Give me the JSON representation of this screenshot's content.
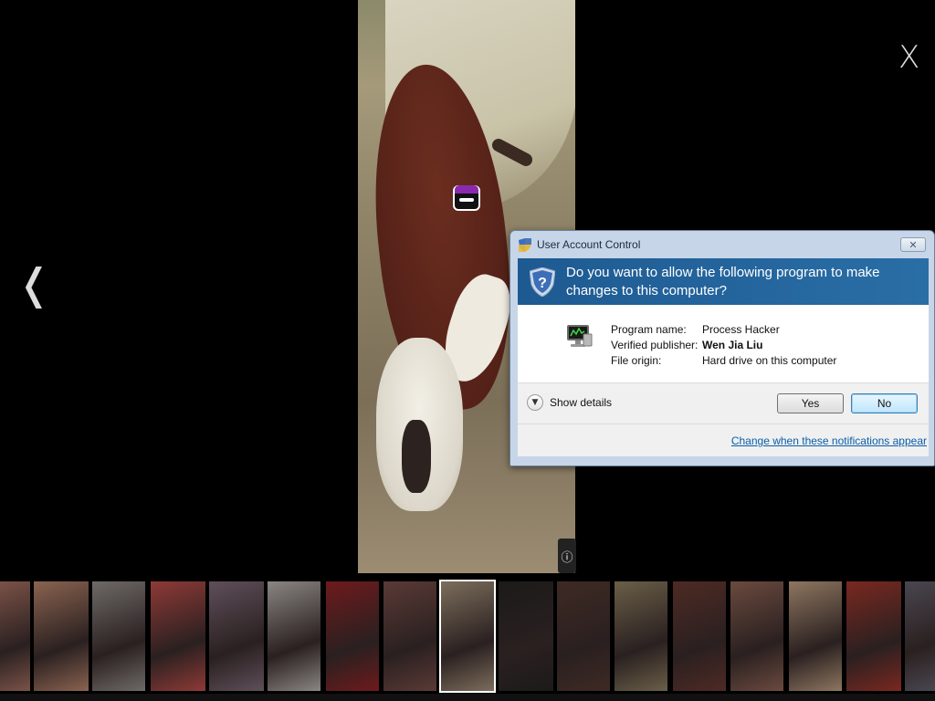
{
  "viewer": {
    "close_glyph": "X",
    "prev_glyph": "❬",
    "info_glyph": "ⓘ"
  },
  "thumbnails": [
    {
      "name": "thumb-1",
      "color": "#7a5248"
    },
    {
      "name": "thumb-2",
      "color": "#8a6350"
    },
    {
      "name": "thumb-3",
      "color": "#6e6a68"
    },
    {
      "name": "thumb-4",
      "color": "#8e3a36"
    },
    {
      "name": "thumb-5",
      "color": "#5f4f5a"
    },
    {
      "name": "thumb-6",
      "color": "#8a8684"
    },
    {
      "name": "thumb-7",
      "color": "#6e1a1c"
    },
    {
      "name": "thumb-8",
      "color": "#5a3a36"
    },
    {
      "name": "thumb-9",
      "color": "#7c6e5c",
      "selected": true
    },
    {
      "name": "thumb-10",
      "color": "#1c1a1a"
    },
    {
      "name": "thumb-11",
      "color": "#3e2a24"
    },
    {
      "name": "thumb-12",
      "color": "#6a5f48"
    },
    {
      "name": "thumb-13",
      "color": "#4e2a24"
    },
    {
      "name": "thumb-14",
      "color": "#6a4a3e"
    },
    {
      "name": "thumb-15",
      "color": "#8e7660"
    },
    {
      "name": "thumb-16",
      "color": "#7a2820"
    },
    {
      "name": "thumb-17",
      "color": "#4a4650"
    }
  ],
  "uac": {
    "title": "User Account Control",
    "close_label": "✕",
    "question": "Do you want to allow the following program to make changes to this computer?",
    "program_name_label": "Program name:",
    "program_name_value": "Process Hacker",
    "publisher_label": "Verified publisher:",
    "publisher_value": "Wen Jia Liu",
    "origin_label": "File origin:",
    "origin_value": "Hard drive on this computer",
    "show_details_label": "Show details",
    "yes_label": "Yes",
    "no_label": "No",
    "change_link_label": "Change when these notifications appear"
  }
}
